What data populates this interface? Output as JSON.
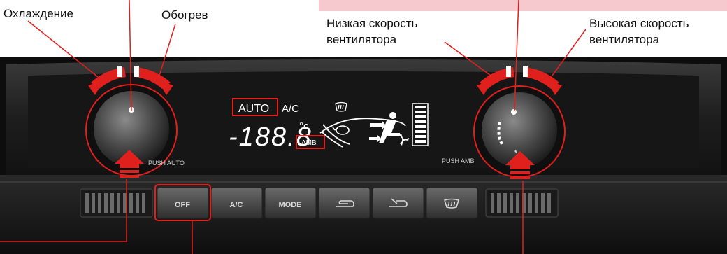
{
  "callouts": {
    "cooling": "Охлаждение",
    "heating": "Обогрев",
    "fan_low_line1": "Низкая скорость",
    "fan_low_line2": "вентилятора",
    "fan_high_line1": "Высокая скорость",
    "fan_high_line2": "вентилятора"
  },
  "display": {
    "auto": "AUTO",
    "ac": "A/C",
    "temp": "-188.8",
    "unit": "°c",
    "amb": "AMB"
  },
  "knobs": {
    "left_push": "PUSH AUTO",
    "right_push": "PUSH AMB"
  },
  "buttons": [
    {
      "id": "off",
      "label": "OFF"
    },
    {
      "id": "ac",
      "label": "A/C"
    },
    {
      "id": "mode",
      "label": "MODE"
    },
    {
      "id": "recirc",
      "label": ""
    },
    {
      "id": "fresh",
      "label": ""
    },
    {
      "id": "defrost",
      "label": ""
    }
  ],
  "colors": {
    "accent": "#e0201c",
    "panel": "#1c1c1c",
    "banner": "#f6c9cf"
  }
}
